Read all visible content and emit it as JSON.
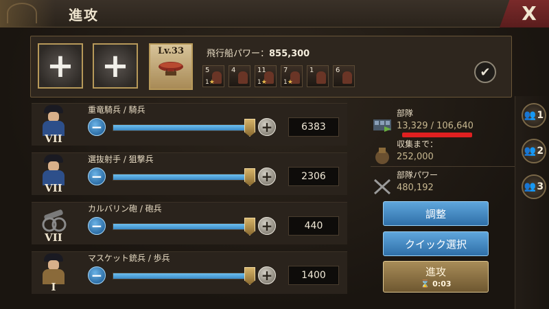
{
  "header": {
    "title": "進攻",
    "close_label": "X"
  },
  "top_panel": {
    "add_slot_label": "+",
    "ship_level": "Lv.33",
    "power_label": "飛行船パワー：",
    "power_value": "855,300",
    "officers": [
      {
        "num": "5",
        "stars": "1"
      },
      {
        "num": "4",
        "stars": ""
      },
      {
        "num": "11",
        "stars": "1"
      },
      {
        "num": "7",
        "stars": "1"
      },
      {
        "num": "1",
        "stars": ""
      },
      {
        "num": "6",
        "stars": ""
      }
    ]
  },
  "troops": [
    {
      "name": "重竜騎兵 / 騎兵",
      "tier": "VII",
      "count": "6383",
      "fill_fraction": 1.0,
      "coat_color": "#2d4f8a"
    },
    {
      "name": "選抜射手 / 狙撃兵",
      "tier": "VII",
      "count": "2306",
      "fill_fraction": 1.0,
      "coat_color": "#2d4f8a"
    },
    {
      "name": "カルバリン砲 / 砲兵",
      "tier": "VII",
      "count": "440",
      "fill_fraction": 1.0,
      "coat_color": "#6b6b6b"
    },
    {
      "name": "マスケット銃兵 / 歩兵",
      "tier": "I",
      "count": "1400",
      "fill_fraction": 1.0,
      "coat_color": "#8a6a3a"
    }
  ],
  "stats": {
    "squad_label": "部隊",
    "squad_value": "13,329 / 106,640",
    "gather_label": "収集まで：",
    "gather_value": "252,000",
    "power_label": "部隊パワー",
    "power_value": "480,192"
  },
  "buttons": {
    "adjust": "調整",
    "quick_select": "クイック選択",
    "march": "進攻",
    "march_time": "0:03"
  },
  "side_tabs": [
    "1",
    "2",
    "3"
  ],
  "control_symbols": {
    "minus": "−",
    "plus": "+",
    "check": "✔"
  },
  "colors": {
    "accent_gold": "#b89a5a",
    "button_blue": "#3a86c4",
    "highlight_red": "#e02020"
  }
}
